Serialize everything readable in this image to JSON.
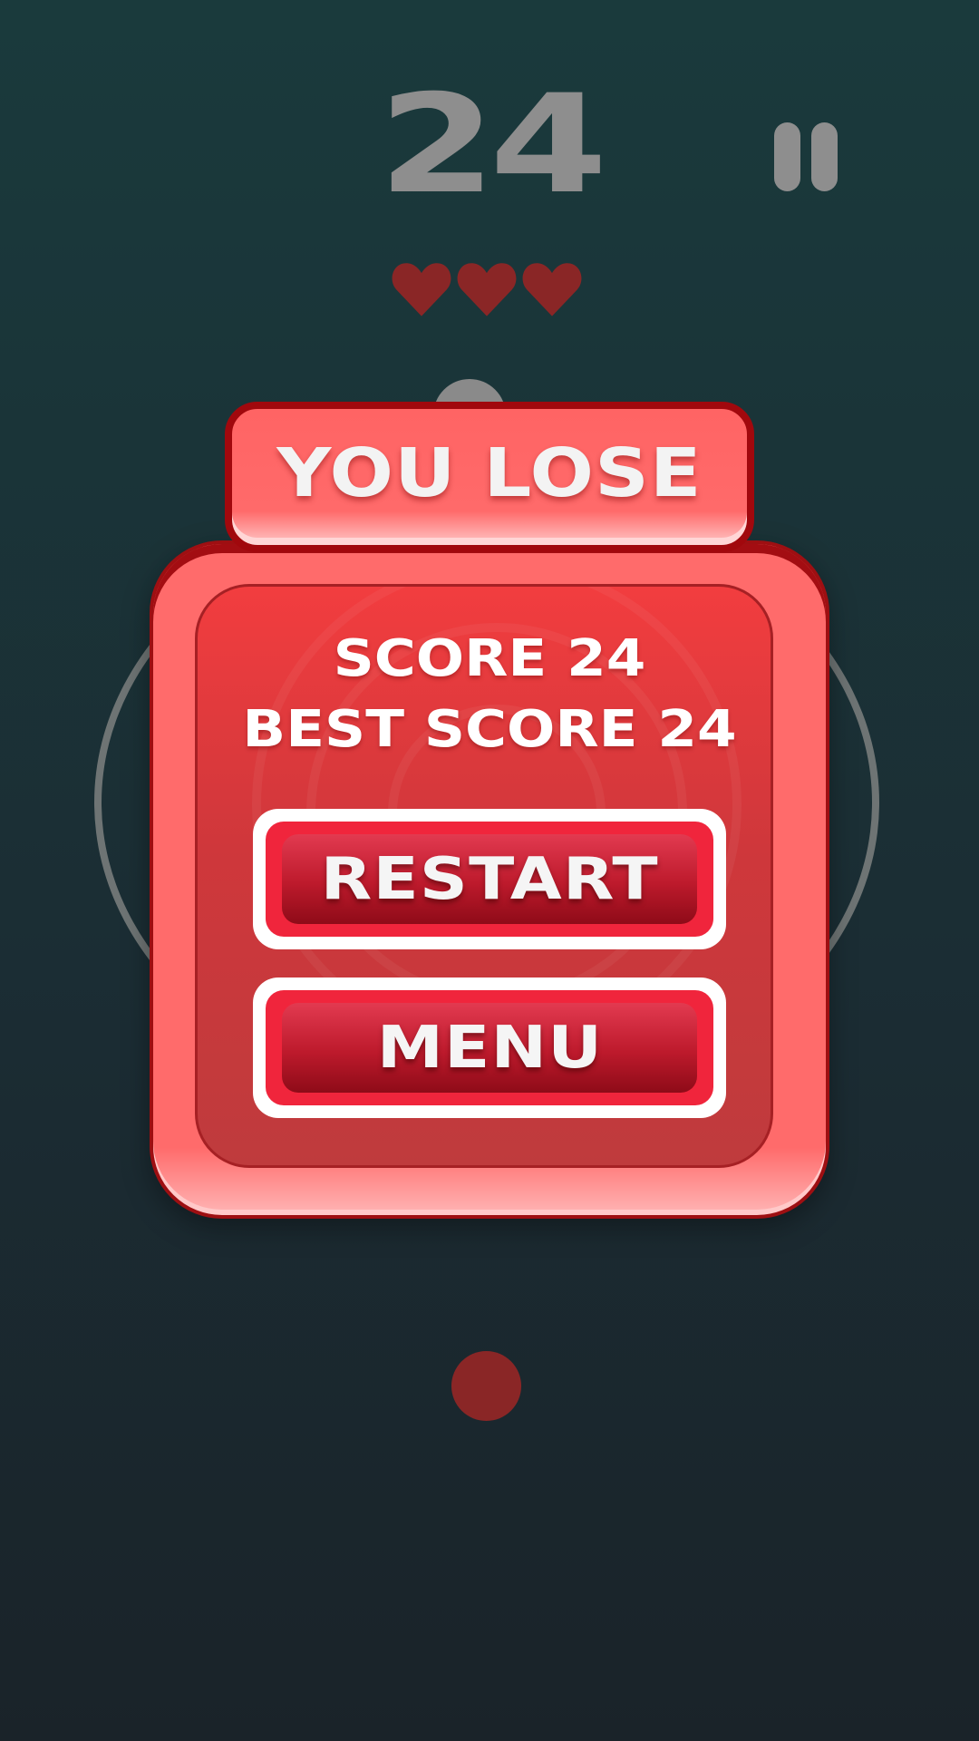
{
  "hud": {
    "score": "24",
    "lives": 3,
    "pause_icon": "pause-icon",
    "heart_icon": "heart-icon"
  },
  "dialog": {
    "title": "YOU LOSE",
    "score_line": "SCORE 24",
    "best_line": "BEST SCORE 24",
    "restart_label": "RESTART",
    "menu_label": "MENU"
  },
  "colors": {
    "background": "#1a3a3c",
    "hud_gray": "#8e8e8e",
    "heart": "#8a2626",
    "panel": "#ff6b6b",
    "panel_inner": "#d8373b",
    "button": "#bd1a2c"
  }
}
